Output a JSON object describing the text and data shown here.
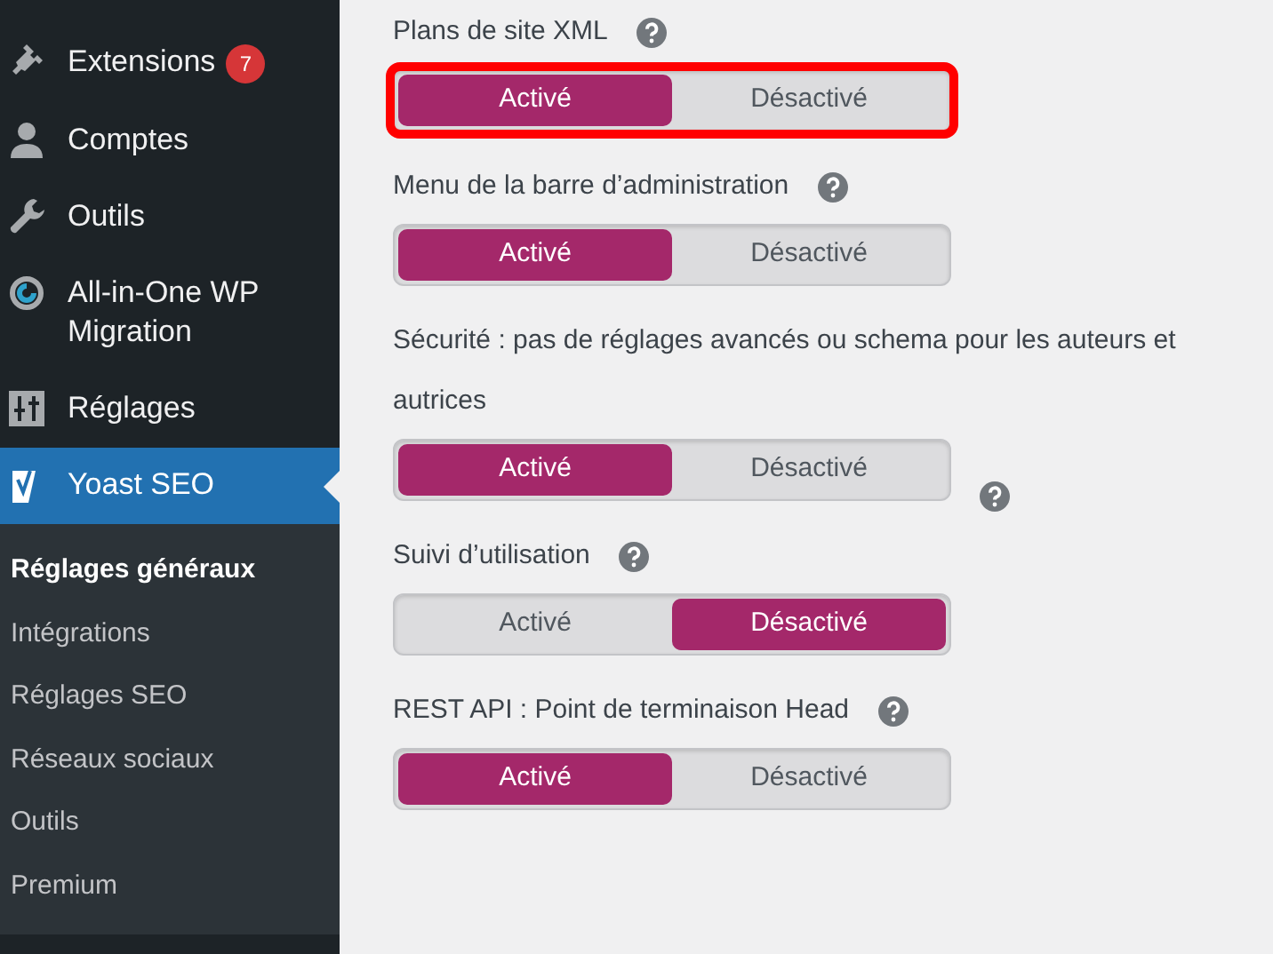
{
  "sidebar": {
    "items": [
      {
        "label": "Extensions",
        "badge": "7",
        "selected": false
      },
      {
        "label": "Comptes",
        "selected": false
      },
      {
        "label": "Outils",
        "selected": false
      },
      {
        "label": "All-in-One WP Migration",
        "selected": false
      },
      {
        "label": "Réglages",
        "selected": false
      },
      {
        "label": "Yoast SEO",
        "selected": true
      }
    ],
    "submenu": [
      {
        "label": "Réglages généraux",
        "selected": true
      },
      {
        "label": "Intégrations",
        "selected": false
      },
      {
        "label": "Réglages SEO",
        "selected": false
      },
      {
        "label": "Réseaux sociaux",
        "selected": false
      },
      {
        "label": "Outils",
        "selected": false
      },
      {
        "label": "Premium",
        "selected": false
      }
    ]
  },
  "settings": [
    {
      "label": "Plans de site XML",
      "kind": "label-help",
      "highlighted": true,
      "options": [
        {
          "label": "Activé",
          "selected": true
        },
        {
          "label": "Désactivé",
          "selected": false
        }
      ]
    },
    {
      "label": "Menu de la barre d’administration",
      "kind": "label-help",
      "highlighted": false,
      "options": [
        {
          "label": "Activé",
          "selected": true
        },
        {
          "label": "Désactivé",
          "selected": false
        }
      ]
    },
    {
      "label": "Sécurité : pas de réglages avancés ou schema pour les auteurs et autrices",
      "kind": "toggle-help",
      "highlighted": false,
      "options": [
        {
          "label": "Activé",
          "selected": true
        },
        {
          "label": "Désactivé",
          "selected": false
        }
      ]
    },
    {
      "label": "Suivi d’utilisation",
      "kind": "label-help",
      "highlighted": false,
      "options": [
        {
          "label": "Activé",
          "selected": false
        },
        {
          "label": "Désactivé",
          "selected": true
        }
      ]
    },
    {
      "label": "REST API : Point de terminaison Head",
      "kind": "label-help",
      "highlighted": false,
      "options": [
        {
          "label": "Activé",
          "selected": true
        },
        {
          "label": "Désactivé",
          "selected": false
        }
      ]
    }
  ]
}
